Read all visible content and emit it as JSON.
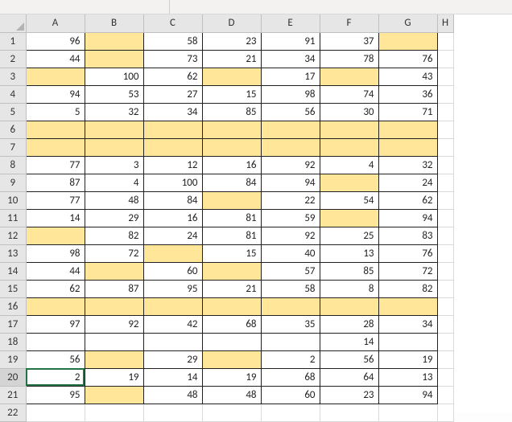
{
  "chart_data": {
    "type": "table",
    "columns": [
      "A",
      "B",
      "C",
      "D",
      "E",
      "F",
      "G"
    ],
    "rows": [
      1,
      2,
      3,
      4,
      5,
      6,
      7,
      8,
      9,
      10,
      11,
      12,
      13,
      14,
      15,
      16,
      17,
      18,
      19,
      20,
      21,
      22
    ],
    "data": {
      "1": {
        "A": 96,
        "B": null,
        "C": 58,
        "D": 23,
        "E": 91,
        "F": 37,
        "G": null
      },
      "2": {
        "A": 44,
        "B": null,
        "C": 73,
        "D": 21,
        "E": 34,
        "F": 78,
        "G": 76
      },
      "3": {
        "A": null,
        "B": 100,
        "C": 62,
        "D": null,
        "E": 17,
        "F": null,
        "G": 43
      },
      "4": {
        "A": 94,
        "B": 53,
        "C": 27,
        "D": 15,
        "E": 98,
        "F": 74,
        "G": 36
      },
      "5": {
        "A": 5,
        "B": 32,
        "C": 34,
        "D": 85,
        "E": 56,
        "F": 30,
        "G": 71
      },
      "6": {
        "A": null,
        "B": null,
        "C": null,
        "D": null,
        "E": null,
        "F": null,
        "G": null
      },
      "7": {
        "A": null,
        "B": null,
        "C": null,
        "D": null,
        "E": null,
        "F": null,
        "G": null
      },
      "8": {
        "A": 77,
        "B": 3,
        "C": 12,
        "D": 16,
        "E": 92,
        "F": 4,
        "G": 32
      },
      "9": {
        "A": 87,
        "B": 4,
        "C": 100,
        "D": 84,
        "E": 94,
        "F": null,
        "G": 24
      },
      "10": {
        "A": 77,
        "B": 48,
        "C": 84,
        "D": null,
        "E": 22,
        "F": 54,
        "G": 62
      },
      "11": {
        "A": 14,
        "B": 29,
        "C": 16,
        "D": 81,
        "E": 59,
        "F": null,
        "G": 94
      },
      "12": {
        "A": null,
        "B": 82,
        "C": 24,
        "D": 81,
        "E": 92,
        "F": 25,
        "G": 83
      },
      "13": {
        "A": 98,
        "B": 72,
        "C": null,
        "D": 15,
        "E": 40,
        "F": 13,
        "G": 76
      },
      "14": {
        "A": 44,
        "B": null,
        "C": 60,
        "D": null,
        "E": 57,
        "F": 85,
        "G": 72
      },
      "15": {
        "A": 62,
        "B": 87,
        "C": 95,
        "D": 21,
        "E": 58,
        "F": 8,
        "G": 82
      },
      "16": {
        "A": null,
        "B": null,
        "C": null,
        "D": null,
        "E": null,
        "F": null,
        "G": null
      },
      "17": {
        "A": 97,
        "B": 92,
        "C": 42,
        "D": 68,
        "E": 35,
        "F": 28,
        "G": 34
      },
      "18": {
        "A": null,
        "B": null,
        "C": null,
        "D": null,
        "E": null,
        "F": 14,
        "G": null
      },
      "19": {
        "A": 56,
        "B": null,
        "C": 29,
        "D": null,
        "E": 2,
        "F": 56,
        "G": 19
      },
      "20": {
        "A": 2,
        "B": 19,
        "C": 14,
        "D": 19,
        "E": 68,
        "F": 64,
        "G": 13
      },
      "21": {
        "A": 95,
        "B": null,
        "C": 48,
        "D": 48,
        "E": 60,
        "F": 23,
        "G": 94
      }
    },
    "highlighted_cells": {
      "1": [
        "B",
        "G"
      ],
      "2": [
        "B"
      ],
      "3": [
        "A",
        "D",
        "F"
      ],
      "6": [
        "A",
        "B",
        "C",
        "D",
        "E",
        "F",
        "G"
      ],
      "7": [
        "A",
        "B",
        "C",
        "D",
        "E",
        "F",
        "G"
      ],
      "9": [
        "F"
      ],
      "10": [
        "D"
      ],
      "11": [
        "F"
      ],
      "12": [
        "A"
      ],
      "13": [
        "C"
      ],
      "14": [
        "B",
        "D"
      ],
      "16": [
        "A",
        "B",
        "C",
        "D",
        "E",
        "F",
        "G"
      ],
      "19": [
        "B",
        "D"
      ],
      "21": [
        "B"
      ]
    }
  },
  "columns": {
    "A": "A",
    "B": "B",
    "C": "C",
    "D": "D",
    "E": "E",
    "F": "F",
    "G": "G",
    "H": "H"
  },
  "rownums": {
    "1": "1",
    "2": "2",
    "3": "3",
    "4": "4",
    "5": "5",
    "6": "6",
    "7": "7",
    "8": "8",
    "9": "9",
    "10": "10",
    "11": "11",
    "12": "12",
    "13": "13",
    "14": "14",
    "15": "15",
    "16": "16",
    "17": "17",
    "18": "18",
    "19": "19",
    "20": "20",
    "21": "21",
    "22": "22"
  },
  "active_cell": "A20",
  "cells": {
    "A1": "96",
    "C1": "58",
    "D1": "23",
    "E1": "91",
    "F1": "37",
    "A2": "44",
    "C2": "73",
    "D2": "21",
    "E2": "34",
    "F2": "78",
    "G2": "76",
    "B3": "100",
    "C3": "62",
    "E3": "17",
    "G3": "43",
    "A4": "94",
    "B4": "53",
    "C4": "27",
    "D4": "15",
    "E4": "98",
    "F4": "74",
    "G4": "36",
    "A5": "5",
    "B5": "32",
    "C5": "34",
    "D5": "85",
    "E5": "56",
    "F5": "30",
    "G5": "71",
    "A8": "77",
    "B8": "3",
    "C8": "12",
    "D8": "16",
    "E8": "92",
    "F8": "4",
    "G8": "32",
    "A9": "87",
    "B9": "4",
    "C9": "100",
    "D9": "84",
    "E9": "94",
    "G9": "24",
    "A10": "77",
    "B10": "48",
    "C10": "84",
    "E10": "22",
    "F10": "54",
    "G10": "62",
    "A11": "14",
    "B11": "29",
    "C11": "16",
    "D11": "81",
    "E11": "59",
    "G11": "94",
    "B12": "82",
    "C12": "24",
    "D12": "81",
    "E12": "92",
    "F12": "25",
    "G12": "83",
    "A13": "98",
    "B13": "72",
    "D13": "15",
    "E13": "40",
    "F13": "13",
    "G13": "76",
    "A14": "44",
    "C14": "60",
    "E14": "57",
    "F14": "85",
    "G14": "72",
    "A15": "62",
    "B15": "87",
    "C15": "95",
    "D15": "21",
    "E15": "58",
    "F15": "8",
    "G15": "82",
    "A17": "97",
    "B17": "92",
    "C17": "42",
    "D17": "68",
    "E17": "35",
    "F17": "28",
    "G17": "34",
    "F18": "14",
    "A19": "56",
    "C19": "29",
    "E19": "2",
    "F19": "56",
    "G19": "19",
    "A20": "2",
    "B20": "19",
    "C20": "14",
    "D20": "19",
    "E20": "68",
    "F20": "64",
    "G20": "13",
    "A21": "95",
    "C21": "48",
    "D21": "48",
    "E21": "60",
    "F21": "23",
    "G21": "94"
  }
}
